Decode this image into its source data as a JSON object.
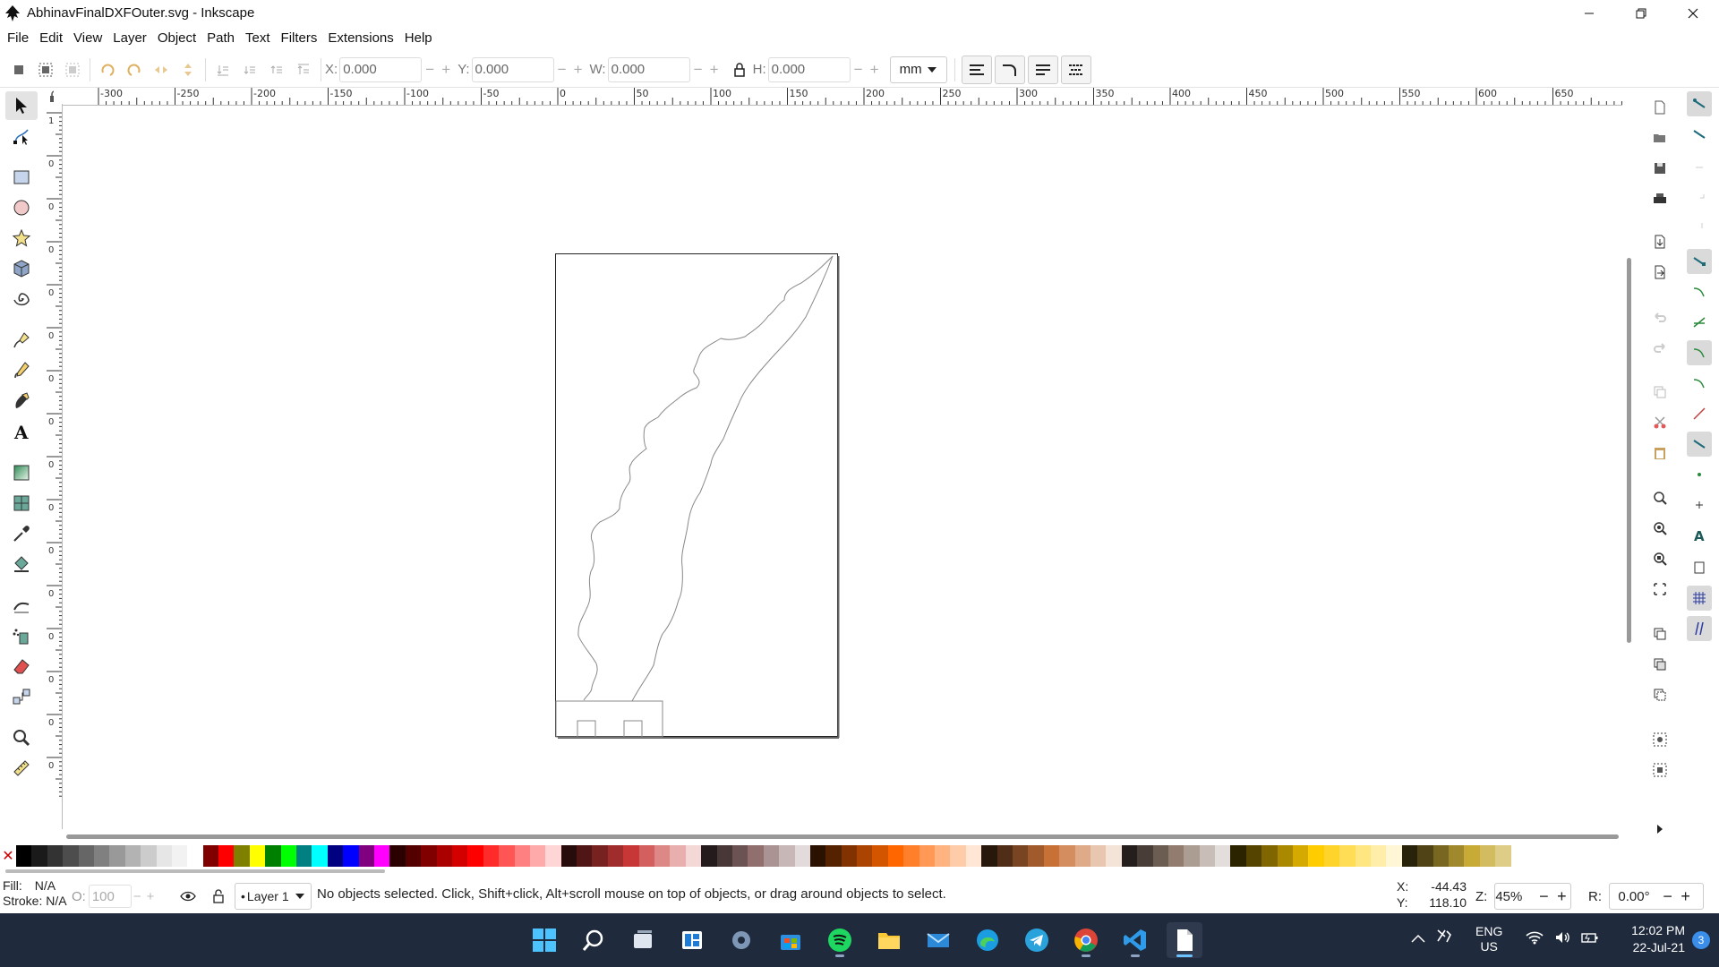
{
  "window": {
    "title": "AbhinavFinalDXFOuter.svg - Inkscape",
    "controls": [
      "minimize-icon",
      "restore-icon",
      "close-icon"
    ]
  },
  "menu": [
    "File",
    "Edit",
    "View",
    "Layer",
    "Object",
    "Path",
    "Text",
    "Filters",
    "Extensions",
    "Help"
  ],
  "toolbar": {
    "x_label": "X:",
    "x_value": "0.000",
    "y_label": "Y:",
    "y_value": "0.000",
    "w_label": "W:",
    "w_value": "0.000",
    "h_label": "H:",
    "h_value": "0.000",
    "minus": "−",
    "plus": "+",
    "unit": "mm"
  },
  "ruler": {
    "h_labels": [
      "-300",
      "-250",
      "-200",
      "-150",
      "-100",
      "-50",
      "0",
      "50",
      "100",
      "150",
      "200",
      "250",
      "300",
      "350",
      "400",
      "450",
      "500",
      "550",
      "600",
      "650"
    ],
    "v_labels": [
      "1",
      "0",
      "0",
      "0",
      "0",
      "0",
      "0",
      "0",
      "0",
      "0",
      "0",
      "0",
      "0",
      "0",
      "0",
      "0"
    ]
  },
  "palette": {
    "none_symbol": "✕",
    "colors": [
      "#000000",
      "#1a1a1a",
      "#333333",
      "#4d4d4d",
      "#666666",
      "#808080",
      "#999999",
      "#b3b3b3",
      "#cccccc",
      "#e6e6e6",
      "#f2f2f2",
      "#ffffff",
      "#800000",
      "#ff0000",
      "#808000",
      "#ffff00",
      "#008000",
      "#00ff00",
      "#008080",
      "#00ffff",
      "#000080",
      "#0000ff",
      "#800080",
      "#ff00ff",
      "#2b0000",
      "#550000",
      "#800000",
      "#aa0000",
      "#d40000",
      "#ff0000",
      "#ff2a2a",
      "#ff5555",
      "#ff8080",
      "#ffaaaa",
      "#ffd5d5",
      "#280b0b",
      "#501616",
      "#782121",
      "#a02c2c",
      "#c83737",
      "#d35f5f",
      "#de8787",
      "#e9afaf",
      "#f4d7d7",
      "#241c1c",
      "#483737",
      "#6c5353",
      "#916f6f",
      "#ac9393",
      "#c8b7b7",
      "#e3dbdb",
      "#2b1100",
      "#552200",
      "#803300",
      "#aa4400",
      "#d45500",
      "#ff6600",
      "#ff7f2a",
      "#ff9955",
      "#ffb380",
      "#ffccaa",
      "#ffe6d5",
      "#28170b",
      "#502d16",
      "#784421",
      "#a05a2c",
      "#c87137",
      "#d38d5f",
      "#deaa87",
      "#e9c6af",
      "#f4e3d7",
      "#241f1c",
      "#483e37",
      "#6c5d53",
      "#917c6f",
      "#ac9d93",
      "#c8beb7",
      "#e3dedb",
      "#2b2200",
      "#554400",
      "#806600",
      "#aa8800",
      "#d4aa00",
      "#ffcc00",
      "#ffd42a",
      "#ffdd55",
      "#ffe680",
      "#ffeeaa",
      "#fff6d5",
      "#28220b",
      "#504416",
      "#786721",
      "#a0892c",
      "#c8ab37",
      "#d3bc5f",
      "#decd87"
    ]
  },
  "status": {
    "fill_label": "Fill:",
    "fill_value": "N/A",
    "stroke_label": "Stroke:",
    "stroke_value": "N/A",
    "opacity_label": "O:",
    "opacity_value": "100",
    "layer": "Layer 1",
    "layer_bullet": "•",
    "message": "No objects selected. Click, Shift+click, Alt+scroll mouse on top of objects, or drag around objects to select.",
    "x_label": "X:",
    "x_value": "-44.43",
    "y_label": "Y:",
    "y_value": "118.10",
    "zoom_label": "Z:",
    "zoom_value": "45%",
    "rotation_label": "R:",
    "rotation_value": "0.00°"
  },
  "taskbar": {
    "apps": [
      "windows-start",
      "search",
      "task-view",
      "widgets",
      "settings",
      "microsoft-store",
      "spotify",
      "file-explorer",
      "mail",
      "edge",
      "telegram",
      "chrome",
      "vscode",
      "inkscape-document"
    ],
    "tray": {
      "language": "ENG",
      "region": "US",
      "time": "12:02 PM",
      "date": "22-Jul-21",
      "notifications": "3"
    }
  }
}
